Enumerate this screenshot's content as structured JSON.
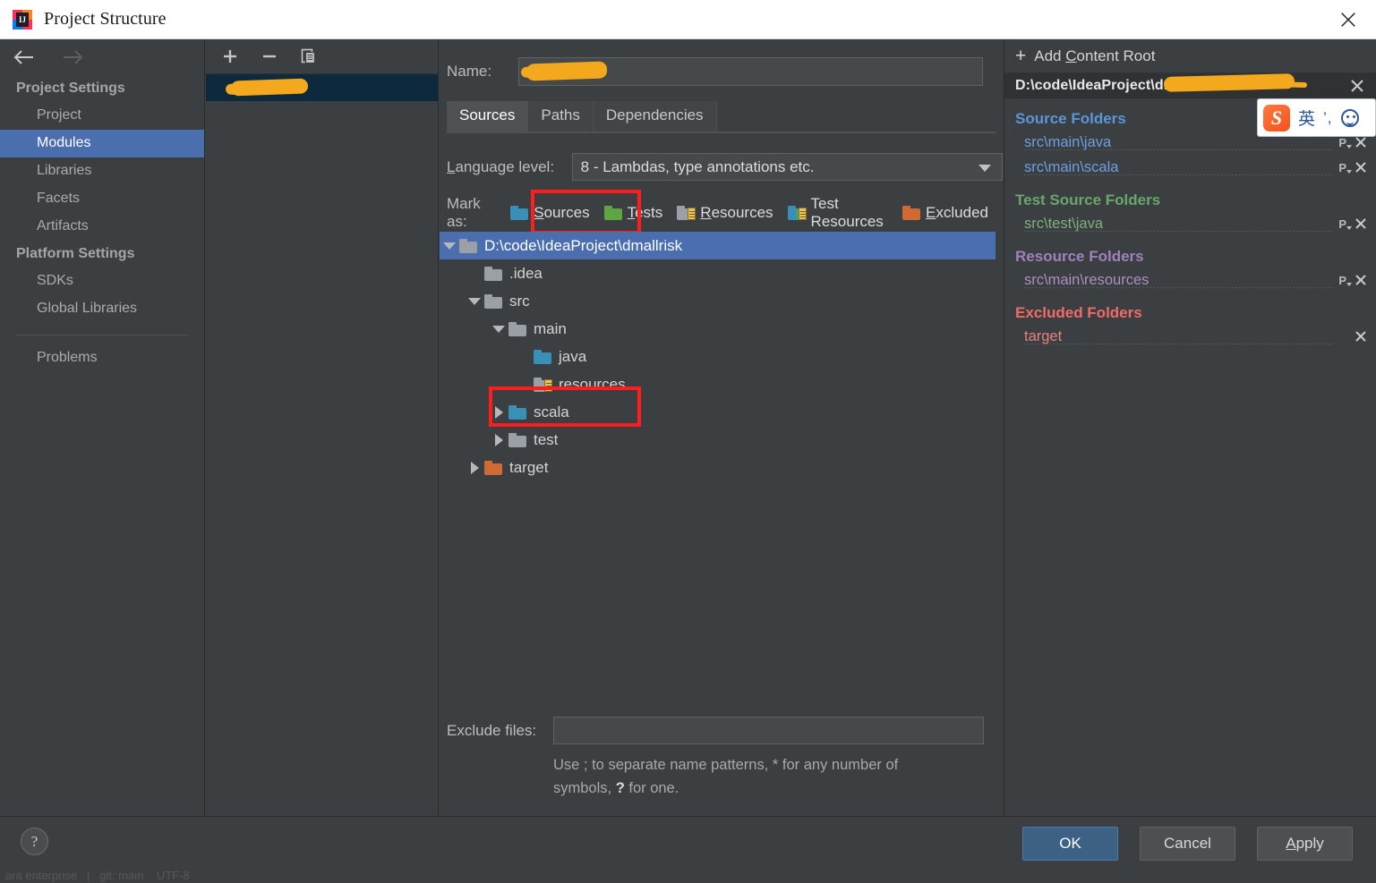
{
  "window": {
    "title": "Project Structure",
    "app_icon": "intellij-idea-icon",
    "close_icon": "close-icon"
  },
  "leftnav": {
    "back_icon": "back-arrow-icon",
    "forward_icon": "forward-arrow-icon",
    "sections": [
      {
        "title": "Project Settings",
        "items": [
          {
            "label": "Project",
            "selected": false
          },
          {
            "label": "Modules",
            "selected": true
          },
          {
            "label": "Libraries",
            "selected": false
          },
          {
            "label": "Facets",
            "selected": false
          },
          {
            "label": "Artifacts",
            "selected": false
          }
        ]
      },
      {
        "title": "Platform Settings",
        "items": [
          {
            "label": "SDKs",
            "selected": false
          },
          {
            "label": "Global Libraries",
            "selected": false
          }
        ]
      }
    ],
    "problems_label": "Problems"
  },
  "modules_panel": {
    "toolbar": {
      "add_icon": "plus-icon",
      "remove_icon": "minus-icon",
      "copy_icon": "copy-icon"
    },
    "items": [
      {
        "label": "",
        "redacted": true,
        "selected": true,
        "icon": "module-folder-icon"
      }
    ]
  },
  "main": {
    "name_label": "Name:",
    "name_value": "",
    "name_redacted": true,
    "tabs": [
      {
        "label": "Sources",
        "active": true
      },
      {
        "label": "Paths",
        "active": false
      },
      {
        "label": "Dependencies",
        "active": false
      }
    ],
    "language_level": {
      "label": "Language level:",
      "value": "8 - Lambdas, type annotations etc.",
      "dropdown_icon": "chevron-down-icon"
    },
    "mark_as": {
      "label": "Mark as:",
      "options": [
        {
          "label": "Sources",
          "mnemonic": "S",
          "color": "#3a8fb7",
          "kind": "plain",
          "highlighted": true
        },
        {
          "label": "Tests",
          "mnemonic": "T",
          "color": "#5fa544",
          "kind": "plain",
          "highlighted": false
        },
        {
          "label": "Resources",
          "mnemonic": "R",
          "color": "#9aa0a6",
          "kind": "lined",
          "highlighted": false
        },
        {
          "label": "Test Resources",
          "mnemonic": "",
          "color": "#5fa544",
          "kind": "lined",
          "highlighted": false
        },
        {
          "label": "Excluded",
          "mnemonic": "E",
          "color": "#cf6a33",
          "kind": "plain",
          "highlighted": false
        }
      ]
    },
    "tree": [
      {
        "label": "D:\\code\\IdeaProject\\dmallrisk",
        "depth": 0,
        "twisty": "down",
        "icon": "folder-gray",
        "selected": true
      },
      {
        "label": ".idea",
        "depth": 1,
        "twisty": "none",
        "icon": "folder-gray",
        "selected": false
      },
      {
        "label": "src",
        "depth": 1,
        "twisty": "down",
        "icon": "folder-gray",
        "selected": false
      },
      {
        "label": "main",
        "depth": 2,
        "twisty": "down",
        "icon": "folder-gray",
        "selected": false
      },
      {
        "label": "java",
        "depth": 3,
        "twisty": "none",
        "icon": "folder-blue",
        "selected": false
      },
      {
        "label": "resources",
        "depth": 3,
        "twisty": "none",
        "icon": "folder-gray-lined",
        "selected": false
      },
      {
        "label": "scala",
        "depth": 3,
        "twisty": "right",
        "icon": "folder-blue",
        "selected": false,
        "highlighted": true
      },
      {
        "label": "test",
        "depth": 2,
        "twisty": "right",
        "icon": "folder-gray",
        "selected": false
      },
      {
        "label": "target",
        "depth": 1,
        "twisty": "right",
        "icon": "folder-orange",
        "selected": false
      }
    ],
    "exclude_files": {
      "label": "Exclude files:",
      "value": "",
      "hint_line1": "Use ; to separate name patterns, * for any number of",
      "hint_line2_prefix": "symbols, ",
      "hint_line2_bold": "?",
      "hint_line2_suffix": " for one."
    }
  },
  "right_panel": {
    "add_content_root": {
      "label": "Add Content Root",
      "mnemonic": "C",
      "icon": "plus-icon"
    },
    "content_root": {
      "path": "D:\\code\\IdeaProject\\dmallrisk",
      "path_visible": "D:\\code\\IdeaProject\\",
      "redacted": true,
      "remove_icon": "close-icon"
    },
    "groups": [
      {
        "title": "Source Folders",
        "kind": "src",
        "color": "#5a95de",
        "rows": [
          {
            "path": "src\\main\\java",
            "package_prefix_icon": "package-prefix-icon",
            "remove_icon": "close-icon"
          },
          {
            "path": "src\\main\\scala",
            "package_prefix_icon": "package-prefix-icon",
            "remove_icon": "close-icon"
          }
        ]
      },
      {
        "title": "Test Source Folders",
        "kind": "test",
        "color": "#6aa76a",
        "rows": [
          {
            "path": "src\\test\\java",
            "package_prefix_icon": "package-prefix-icon",
            "remove_icon": "close-icon"
          }
        ]
      },
      {
        "title": "Resource Folders",
        "kind": "res",
        "color": "#9f82bd",
        "rows": [
          {
            "path": "src\\main\\resources",
            "package_prefix_icon": "package-prefix-icon",
            "remove_icon": "close-icon"
          }
        ]
      },
      {
        "title": "Excluded Folders",
        "kind": "exc",
        "color": "#f06a6a",
        "rows": [
          {
            "path": "target",
            "package_prefix_icon": "",
            "remove_icon": "close-icon"
          }
        ]
      }
    ]
  },
  "bottom": {
    "help_label": "?",
    "ok_label": "OK",
    "cancel_label": "Cancel",
    "apply_label": "Apply",
    "apply_mnemonic": "A"
  },
  "ime": {
    "logo_text": "S",
    "mode_label": "英",
    "punctuation_label": "’,",
    "smiley_icon": "smiley-icon"
  },
  "colors": {
    "accent_selection": "#4b6eaf",
    "dialog_bg": "#3c3f41",
    "primary_button": "#3d6185",
    "highlight_box": "#ff1d1d",
    "redaction": "#f4a81d"
  }
}
